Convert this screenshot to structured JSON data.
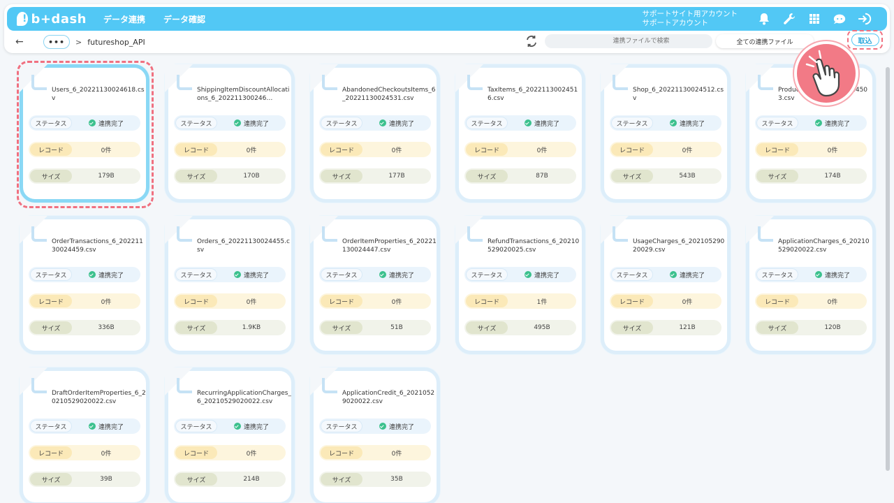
{
  "header": {
    "logo_text": "b+dash",
    "nav": [
      "データ連携",
      "データ確認"
    ],
    "account_line1": "サポートサイト用アカウント",
    "account_line2": "サポートアカウント",
    "icons": [
      "bell-icon",
      "wrench-icon",
      "grid-icon",
      "chat-badge-icon",
      "logout-icon"
    ]
  },
  "subbar": {
    "back": "←",
    "more": "•••",
    "separator": ">",
    "current": "futureshop_API",
    "search_placeholder": "連携ファイルで検索",
    "filter": "全ての連携ファイル",
    "filter_extra": "",
    "import": "取込"
  },
  "labels": {
    "status": "ステータス",
    "record": "レコード",
    "size": "サイズ"
  },
  "files": [
    {
      "name": "Users_6_20221130024618.csv",
      "status": "連携完了",
      "record": "0件",
      "size": "179B"
    },
    {
      "name": "ShippingItemDiscountAllocations_6_202211300246…",
      "status": "連携完了",
      "record": "0件",
      "size": "170B"
    },
    {
      "name": "AbandonedCheckoutsItems_6_20221130024531.csv",
      "status": "連携完了",
      "record": "0件",
      "size": "177B"
    },
    {
      "name": "TaxItems_6_20221130024516.csv",
      "status": "連携完了",
      "record": "0件",
      "size": "87B"
    },
    {
      "name": "Shop_6_20221130024512.csv",
      "status": "連携完了",
      "record": "0件",
      "size": "543B"
    },
    {
      "name": "Products_6_20221130024503.csv",
      "status": "連携完了",
      "record": "0件",
      "size": "174B"
    },
    {
      "name": "OrderTransactions_6_20221130024459.csv",
      "status": "連携完了",
      "record": "0件",
      "size": "336B"
    },
    {
      "name": "Orders_6_20221130024455.csv",
      "status": "連携完了",
      "record": "0件",
      "size": "1.9KB"
    },
    {
      "name": "OrderItemProperties_6_20221130024447.csv",
      "status": "連携完了",
      "record": "0件",
      "size": "51B"
    },
    {
      "name": "RefundTransactions_6_20210529020025.csv",
      "status": "連携完了",
      "record": "1件",
      "size": "495B"
    },
    {
      "name": "UsageCharges_6_20210529020029.csv",
      "status": "連携完了",
      "record": "0件",
      "size": "121B"
    },
    {
      "name": "ApplicationCharges_6_20210529020022.csv",
      "status": "連携完了",
      "record": "0件",
      "size": "120B"
    },
    {
      "name": "DraftOrderItemProperties_6_20210529020022.csv",
      "status": "連携完了",
      "record": "0件",
      "size": "39B"
    },
    {
      "name": "RecurringApplicationCharges_6_20210529020022.csv",
      "status": "連携完了",
      "record": "0件",
      "size": "214B"
    },
    {
      "name": "ApplicationCredit_6_20210529020022.csv",
      "status": "連携完了",
      "record": "0件",
      "size": "35B"
    }
  ],
  "colors": {
    "header": "#52c8f5",
    "highlight": "#f07080",
    "check": "#3cc18e"
  }
}
